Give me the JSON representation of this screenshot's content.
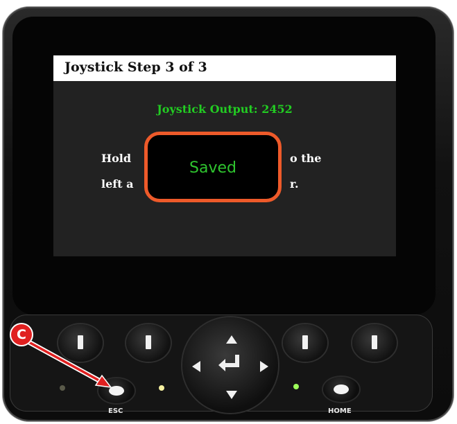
{
  "screen": {
    "title": "Joystick Step 3 of 3",
    "output": "Joystick Output: 2452",
    "instruction_line1_left": "Hold",
    "instruction_line1_right": "o the",
    "instruction_line2_left": "left a",
    "instruction_line2_right": "r."
  },
  "popup": {
    "text": "Saved"
  },
  "buttons": {
    "esc_label": "ESC",
    "home_label": "HOME"
  },
  "annotation": {
    "marker": "C"
  },
  "colors": {
    "output_green": "#22cc22",
    "popup_border": "#ee5a2a",
    "annotation_red": "#e02020",
    "led_green": "#9dff5a",
    "led_yellow": "#f5f0a0"
  },
  "icons": [
    "arrow-up-icon",
    "arrow-down-icon",
    "arrow-left-icon",
    "arrow-right-icon",
    "enter-icon"
  ]
}
